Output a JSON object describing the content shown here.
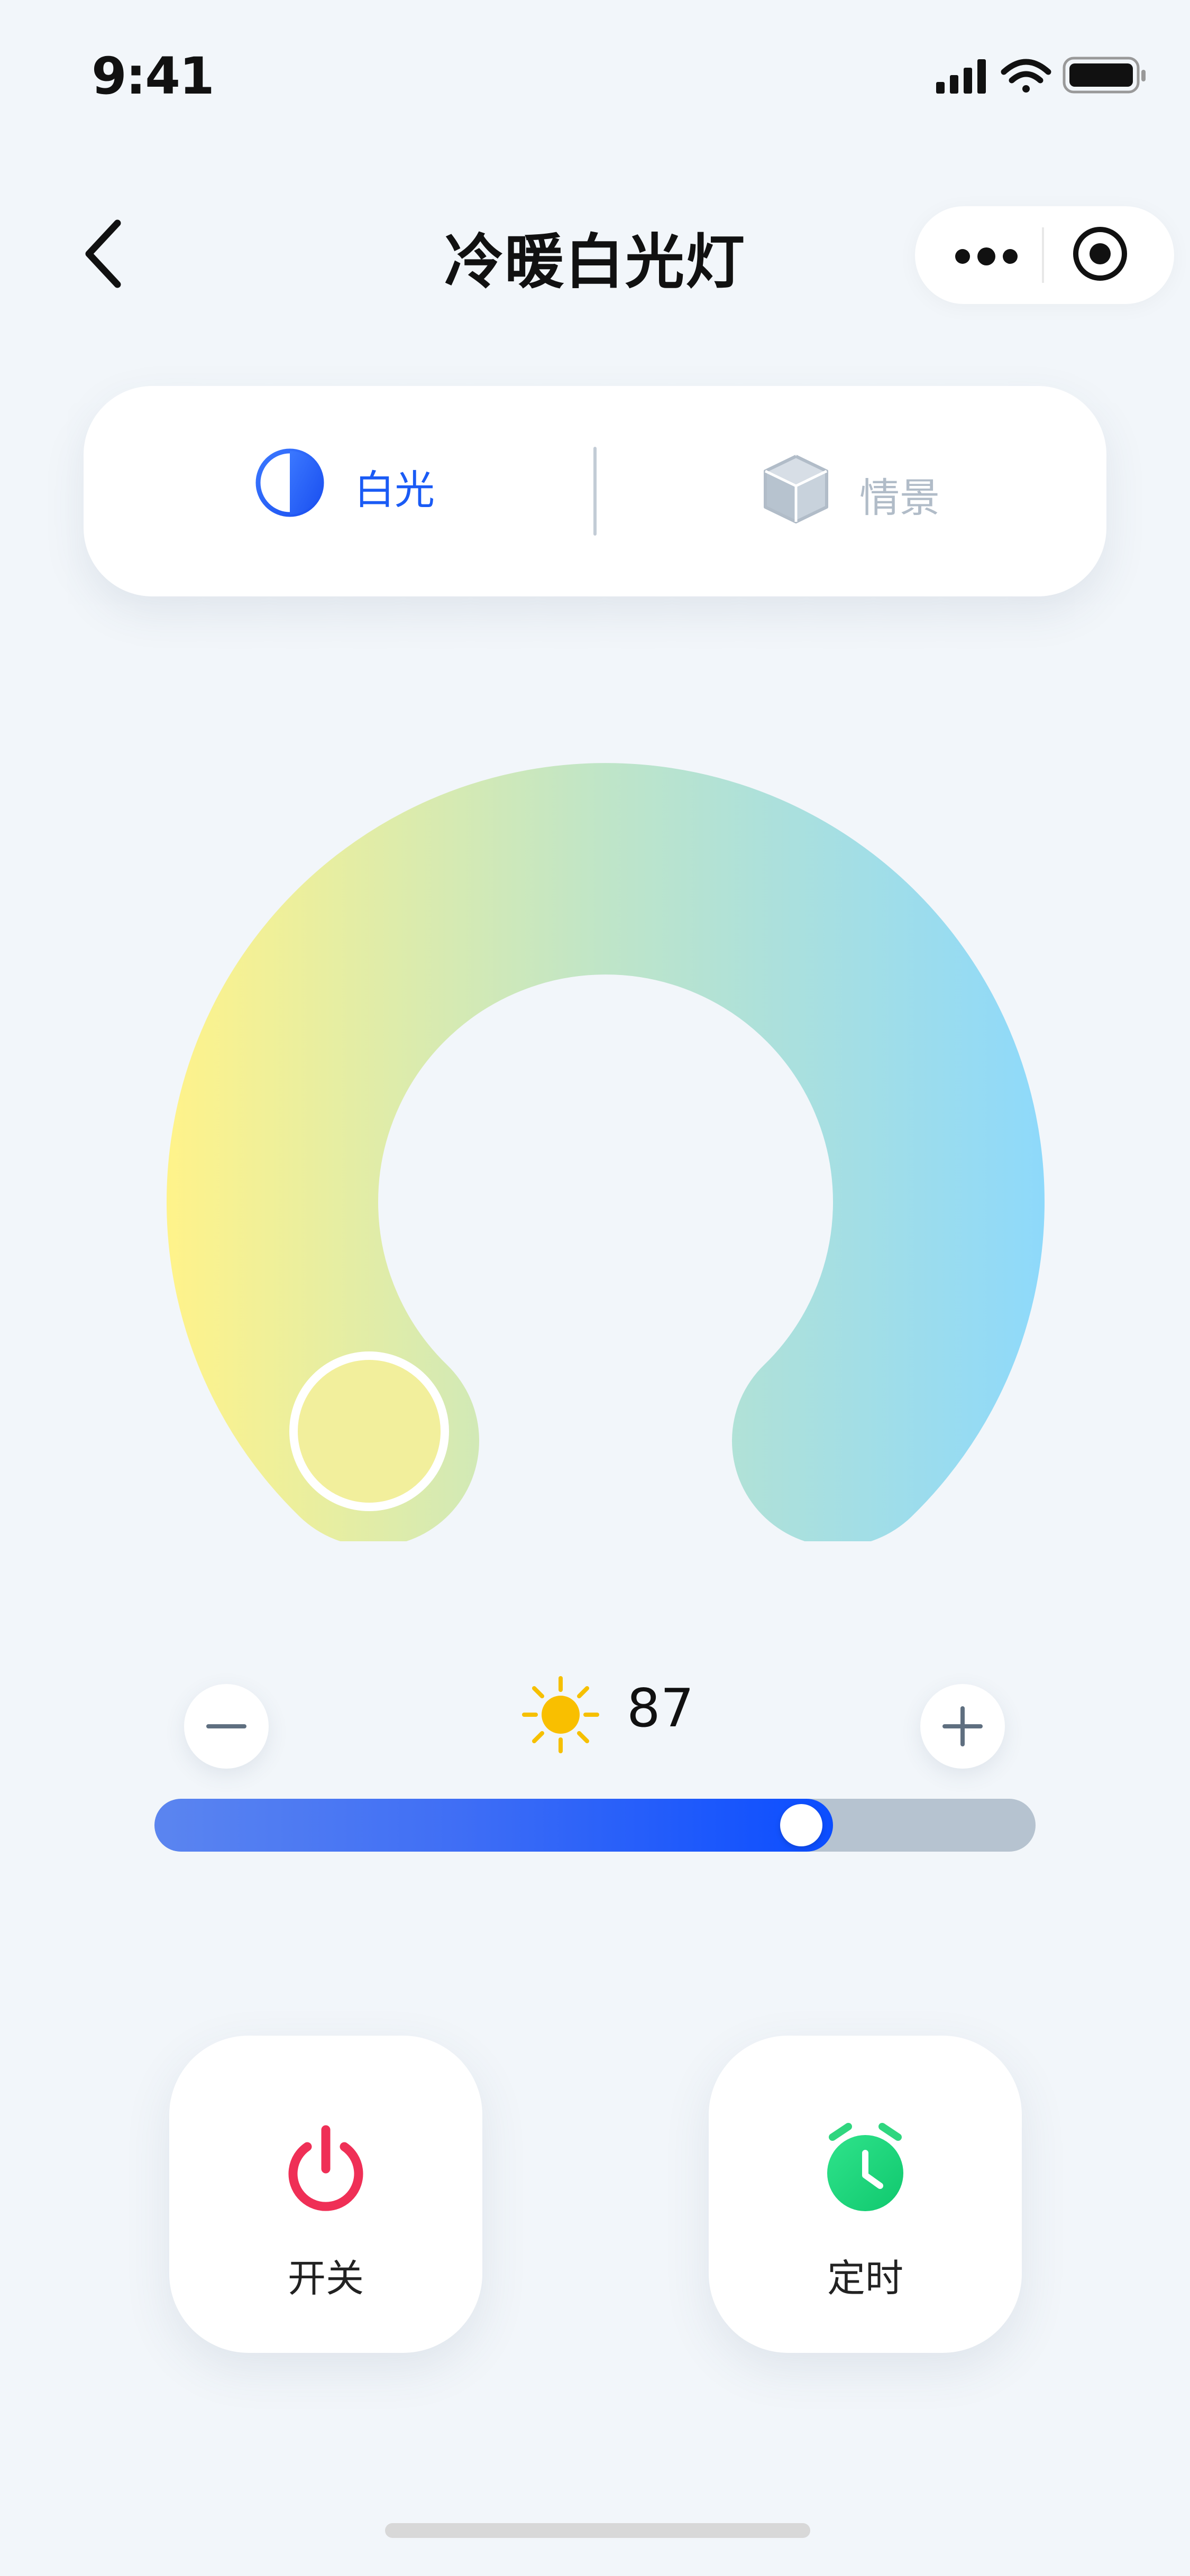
{
  "status_bar": {
    "time": "9:41",
    "icons": [
      "cellular-signal-icon",
      "wifi-icon",
      "battery-icon"
    ]
  },
  "nav": {
    "title": "冷暖白光灯",
    "back_icon": "chevron-left-icon",
    "capsule": {
      "more_icon": "more-dots-icon",
      "close_icon": "target-icon"
    }
  },
  "modes": {
    "white": {
      "label": "白光",
      "icon": "half-circle-icon",
      "active": true
    },
    "scene": {
      "label": "情景",
      "icon": "cube-icon",
      "active": false
    }
  },
  "color_ring": {
    "warm_color": "#fff38a",
    "neutral_color": "#bfe5c8",
    "cool_color": "#8ed9fb",
    "selector_position": 0.0
  },
  "brightness": {
    "value": "87",
    "level_fraction": 0.77,
    "icon": "sun-icon",
    "minus_icon": "minus-icon",
    "plus_icon": "plus-icon"
  },
  "actions": {
    "power": {
      "label": "开关",
      "icon": "power-icon",
      "color": "#ef2f56"
    },
    "timer": {
      "label": "定时",
      "icon": "alarm-clock-icon",
      "color": "#22d27a"
    }
  },
  "colors": {
    "accent": "#1a5bf5",
    "background": "#f2f6fa"
  }
}
